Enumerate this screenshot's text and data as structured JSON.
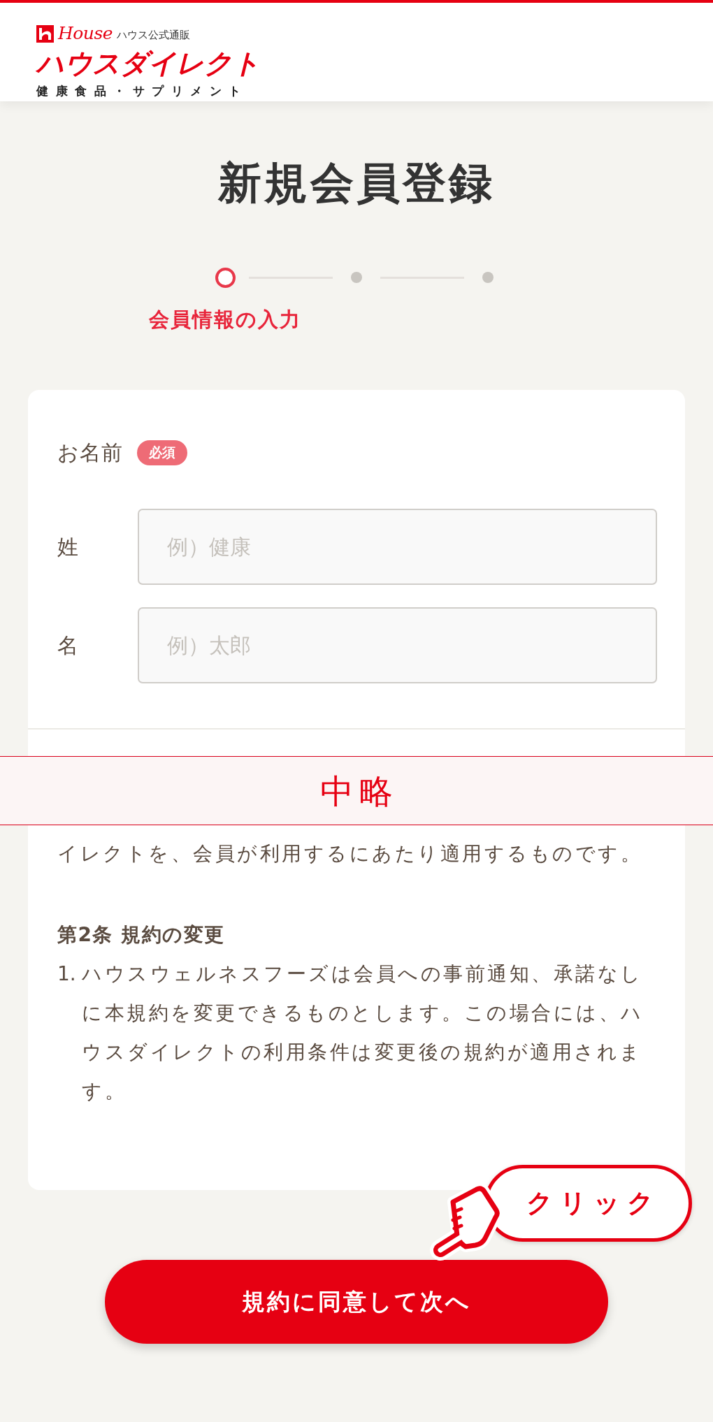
{
  "header": {
    "logo": {
      "brand": "House",
      "tagline": "ハウス公式通販",
      "site_name": "ハウスダイレクト",
      "subtitle": "健康食品・サプリメント"
    }
  },
  "page_title": "新規会員登録",
  "stepper": {
    "steps": [
      {
        "label": "会員情報の入力",
        "selected": true
      },
      {
        "selected": false
      },
      {
        "selected": false
      }
    ]
  },
  "form": {
    "group_label": "お名前",
    "badge": "必須",
    "fields": [
      {
        "label": "姓",
        "placeholder": "例）健康"
      },
      {
        "label": "名",
        "placeholder": "例）太郎"
      }
    ]
  },
  "omission_banner": {
    "text": "中略"
  },
  "terms": {
    "intro": "イレクトを、会員が利用するにあたり適用するものです。",
    "sections": [
      {
        "heading": "第2条 規約の変更",
        "items": [
          {
            "number": "1.",
            "text": "ハウスウェルネスフーズは会員への事前通知、承諾なしに本規約を変更できるものとします。この場合には、ハウスダイレクトの利用条件は変更後の規約が適用されます。"
          }
        ]
      }
    ]
  },
  "callout": {
    "text": "クリック"
  },
  "submit_button": {
    "label": "規約に同意して次へ"
  }
}
